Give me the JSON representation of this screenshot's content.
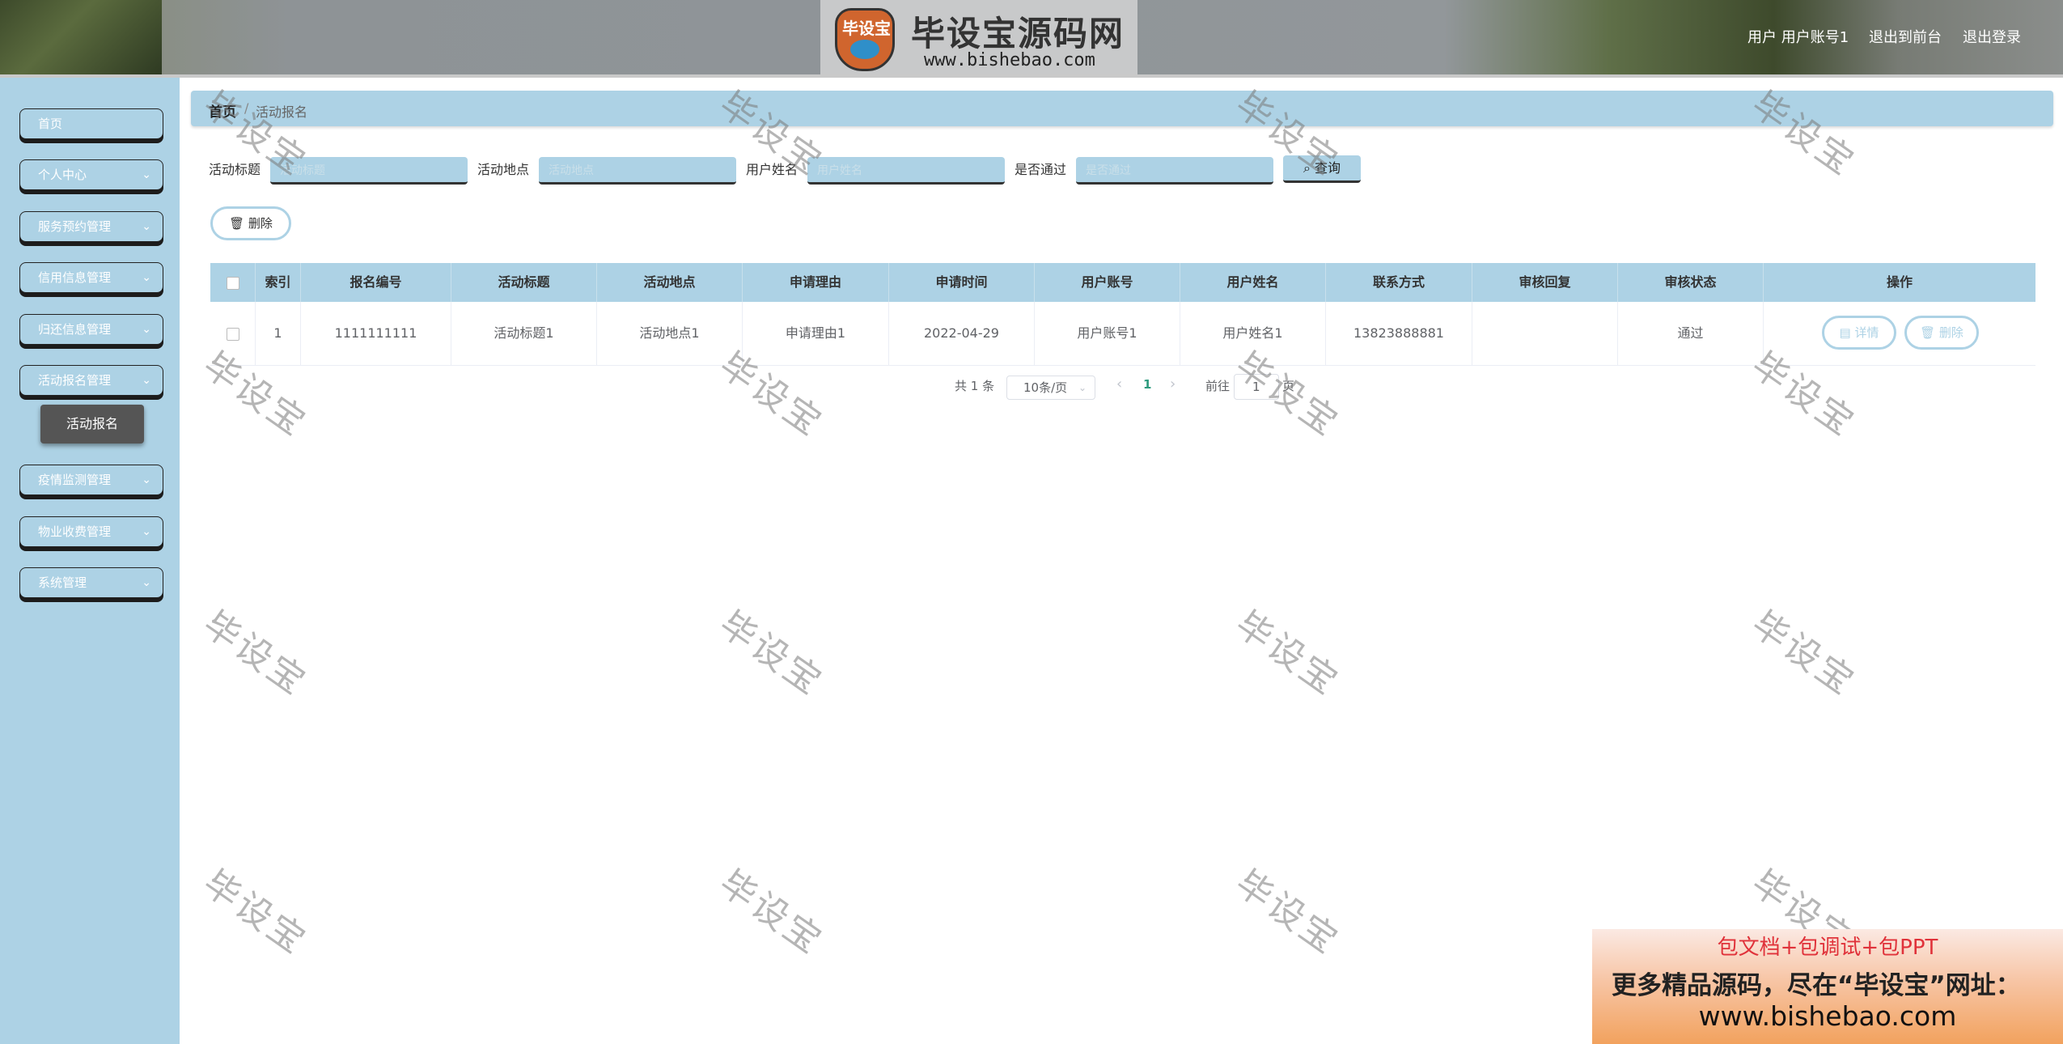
{
  "header": {
    "logo_badge": "毕设宝",
    "logo_title": "毕设宝源码网",
    "logo_url": "www.bishebao.com",
    "user_label": "用户 用户账号1",
    "front_link": "退出到前台",
    "logout_link": "退出登录"
  },
  "sidebar": {
    "items": [
      {
        "label": "首页"
      },
      {
        "label": "个人中心"
      },
      {
        "label": "服务预约管理"
      },
      {
        "label": "信用信息管理"
      },
      {
        "label": "归还信息管理"
      },
      {
        "label": "活动报名管理"
      },
      {
        "label": "疫情监测管理"
      },
      {
        "label": "物业收费管理"
      },
      {
        "label": "系统管理"
      }
    ],
    "sub_item": "活动报名"
  },
  "breadcrumb": {
    "home": "首页",
    "separator": "/",
    "current": "活动报名"
  },
  "filters": {
    "title_label": "活动标题",
    "title_placeholder": "活动标题",
    "place_label": "活动地点",
    "place_placeholder": "活动地点",
    "name_label": "用户姓名",
    "name_placeholder": "用户姓名",
    "pass_label": "是否通过",
    "pass_placeholder": "是否通过",
    "query_button": "查询"
  },
  "toolbar": {
    "delete_button": "删除"
  },
  "table": {
    "columns": [
      "索引",
      "报名编号",
      "活动标题",
      "活动地点",
      "申请理由",
      "申请时间",
      "用户账号",
      "用户姓名",
      "联系方式",
      "审核回复",
      "审核状态",
      "操作"
    ],
    "rows": [
      {
        "index": "1",
        "code": "1111111111",
        "title": "活动标题1",
        "place": "活动地点1",
        "reason": "申请理由1",
        "time": "2022-04-29",
        "account": "用户账号1",
        "name": "用户姓名1",
        "phone": "13823888881",
        "reply": "",
        "status": "通过",
        "detail_button": "详情",
        "delete_button": "删除"
      }
    ]
  },
  "pagination": {
    "total": "共 1 条",
    "page_size": "10条/页",
    "current_page": "1",
    "goto_label": "前往",
    "goto_value": "1",
    "page_suffix": "页"
  },
  "watermark": "毕设宝",
  "ad": {
    "line1": "包文档+包调试+包PPT",
    "line2": "更多精品源码，尽在“毕设宝”网址：",
    "line3": "www.bishebao.com"
  },
  "colors": {
    "accent": "#add2e5",
    "active_page": "#2f9b7e",
    "ad_red": "#e0323a"
  }
}
